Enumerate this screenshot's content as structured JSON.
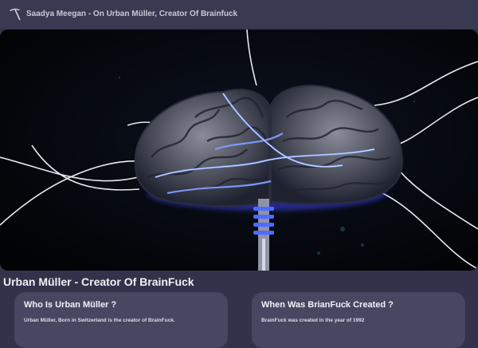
{
  "header": {
    "logo_icon": "pickaxe-icon",
    "title": "Saadya Meegan - On Urban Müller, Creator Of Brainfuck"
  },
  "hero": {
    "image": "glowing-brain-illustration"
  },
  "main": {
    "heading": "Urban Müller - Creator Of BrainFuck",
    "cards": [
      {
        "title": "Who Is Urban Müller ?",
        "text": "Urban Müller, Born in Switzerland is the creator of BrainFuck."
      },
      {
        "title": "When Was BrianFuck Created ?",
        "text": "BrainFuck was created in the year of 1992"
      }
    ]
  },
  "colors": {
    "background": "#33324a",
    "card": "#484761",
    "glow": "#5a6bff"
  }
}
